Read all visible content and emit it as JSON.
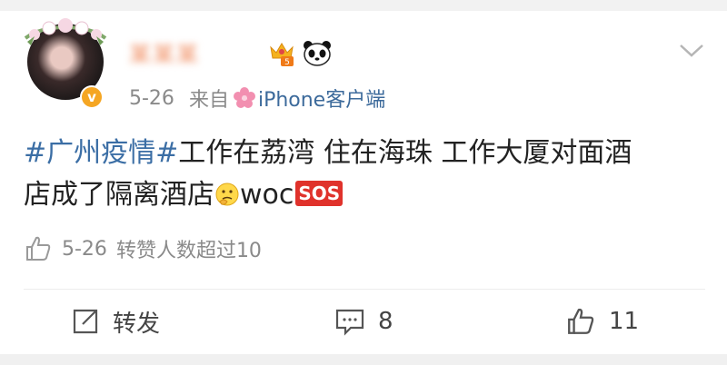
{
  "post": {
    "username": "某某某",
    "date": "5-26",
    "source_prefix": "来自",
    "source": "iPhone客户端",
    "hashtag": "#广州疫情#",
    "text_line1": "工作在荔湾 住在海珠 工作大厦对面酒",
    "text_line2": "店成了隔离酒店",
    "text_tail": "woc",
    "sos_label": "SOS",
    "like_date": "5-26",
    "like_summary": "转赞人数超过10"
  },
  "actions": {
    "repost_label": "转发",
    "comment_count": "8",
    "like_count": "11"
  },
  "icons": [
    "flower-crown-icon",
    "verified-badge-icon",
    "crown-badge-icon",
    "panda-icon",
    "chevron-down-icon",
    "flower-icon",
    "thinking-face-icon",
    "sos-icon",
    "thumbs-up-icon",
    "repost-icon",
    "comment-icon"
  ],
  "colors": {
    "link": "#3b6ea5",
    "meta": "#8a8a8a",
    "verified": "#f5a623",
    "sos": "#e0322b"
  }
}
